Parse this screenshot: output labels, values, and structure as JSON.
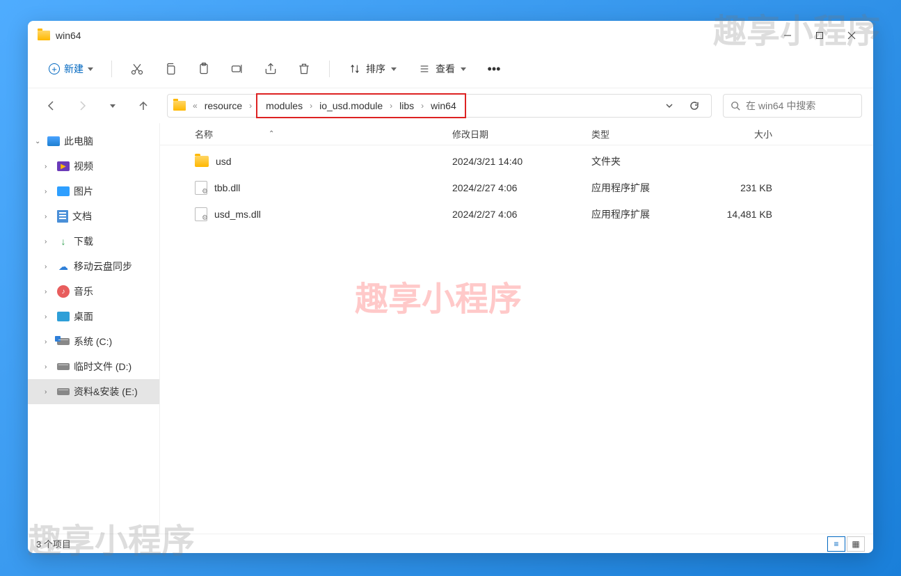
{
  "watermark": "趣享小程序",
  "window": {
    "title": "win64"
  },
  "toolbar": {
    "new_label": "新建",
    "sort_label": "排序",
    "view_label": "查看"
  },
  "breadcrumb": {
    "ellipsis": "«",
    "items": [
      "resource",
      "modules",
      "io_usd.module",
      "libs",
      "win64"
    ]
  },
  "search": {
    "placeholder": "在 win64 中搜索"
  },
  "sidebar": {
    "root": "此电脑",
    "items": [
      {
        "label": "视频",
        "icon": "video"
      },
      {
        "label": "图片",
        "icon": "image"
      },
      {
        "label": "文档",
        "icon": "doc"
      },
      {
        "label": "下载",
        "icon": "download"
      },
      {
        "label": "移动云盘同步",
        "icon": "cloud"
      },
      {
        "label": "音乐",
        "icon": "music"
      },
      {
        "label": "桌面",
        "icon": "desktop"
      },
      {
        "label": "系统 (C:)",
        "icon": "sys-drive"
      },
      {
        "label": "临时文件 (D:)",
        "icon": "drive"
      },
      {
        "label": "资料&安装 (E:)",
        "icon": "drive"
      }
    ]
  },
  "columns": {
    "name": "名称",
    "date": "修改日期",
    "type": "类型",
    "size": "大小"
  },
  "files": [
    {
      "name": "usd",
      "date": "2024/3/21 14:40",
      "type": "文件夹",
      "size": "",
      "kind": "folder"
    },
    {
      "name": "tbb.dll",
      "date": "2024/2/27 4:06",
      "type": "应用程序扩展",
      "size": "231 KB",
      "kind": "dll"
    },
    {
      "name": "usd_ms.dll",
      "date": "2024/2/27 4:06",
      "type": "应用程序扩展",
      "size": "14,481 KB",
      "kind": "dll"
    }
  ],
  "statusbar": {
    "items_text": "3 个项目"
  }
}
